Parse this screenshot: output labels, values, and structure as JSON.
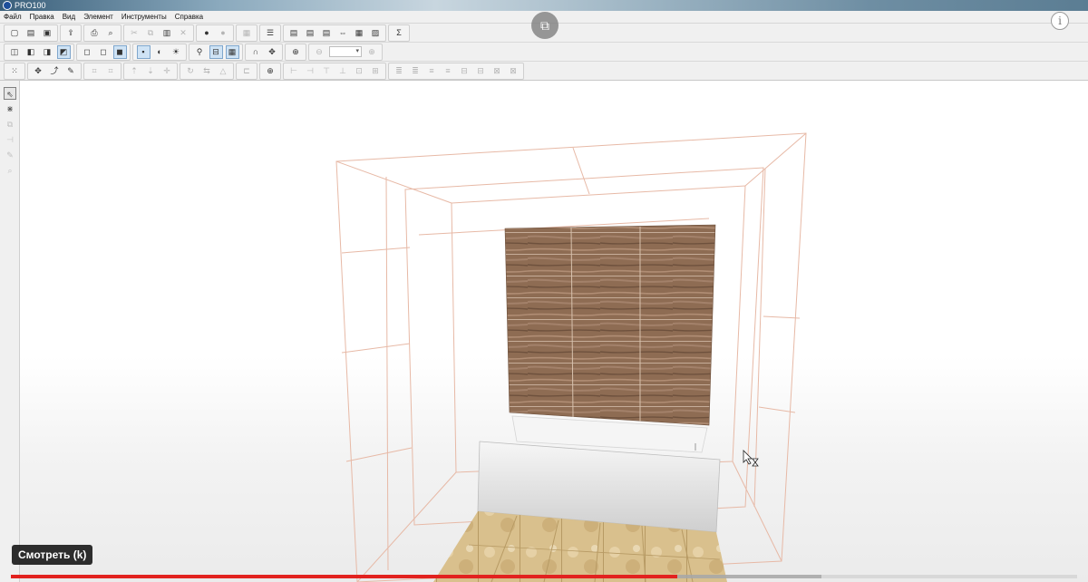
{
  "window": {
    "title": "PRO100"
  },
  "menu": [
    "Файл",
    "Правка",
    "Вид",
    "Элемент",
    "Инструменты",
    "Справка"
  ],
  "toolbar_1": {
    "groups": [
      [
        {
          "name": "new-icon",
          "glyph": "▢"
        },
        {
          "name": "open-icon",
          "glyph": "▤"
        },
        {
          "name": "save-icon",
          "glyph": "▣"
        }
      ],
      [
        {
          "name": "export-icon",
          "glyph": "⇪"
        }
      ],
      [
        {
          "name": "print-icon",
          "glyph": "⎙"
        },
        {
          "name": "print-preview-icon",
          "glyph": "⌕"
        }
      ],
      [
        {
          "name": "cut-icon",
          "glyph": "✂",
          "disabled": true
        },
        {
          "name": "copy-icon",
          "glyph": "⧉",
          "disabled": true
        },
        {
          "name": "paste-icon",
          "glyph": "▥"
        },
        {
          "name": "delete-icon",
          "glyph": "✕",
          "disabled": true
        }
      ],
      [
        {
          "name": "undo-icon",
          "glyph": "●"
        },
        {
          "name": "redo-icon",
          "glyph": "●",
          "disabled": true
        }
      ],
      [
        {
          "name": "properties-icon",
          "glyph": "▦",
          "disabled": true
        }
      ],
      [
        {
          "name": "element-list-icon",
          "glyph": "☰"
        }
      ],
      [
        {
          "name": "library-icon",
          "glyph": "▤"
        },
        {
          "name": "library-add-icon",
          "glyph": "▤"
        },
        {
          "name": "library-edit-icon",
          "glyph": "▤"
        },
        {
          "name": "dimensions-icon",
          "glyph": "⇔"
        },
        {
          "name": "report-icon",
          "glyph": "▦"
        },
        {
          "name": "catalog-icon",
          "glyph": "▨"
        }
      ],
      [
        {
          "name": "sum-icon",
          "glyph": "Σ"
        }
      ]
    ]
  },
  "toolbar_2": {
    "groups": [
      [
        {
          "name": "view-front-icon",
          "glyph": "◫"
        },
        {
          "name": "view-side-icon",
          "glyph": "◧"
        },
        {
          "name": "view-top-icon",
          "glyph": "◨"
        },
        {
          "name": "view-3d-icon",
          "glyph": "◩",
          "active": true
        }
      ],
      [
        {
          "name": "wireframe-icon",
          "glyph": "◻"
        },
        {
          "name": "hidden-lines-icon",
          "glyph": "◻"
        },
        {
          "name": "shaded-icon",
          "glyph": "◼",
          "active": true
        }
      ],
      [
        {
          "name": "texture-icon",
          "glyph": "▪",
          "active": true
        },
        {
          "name": "shadow-icon",
          "glyph": "◐"
        },
        {
          "name": "light-icon",
          "glyph": "☀"
        }
      ],
      [
        {
          "name": "measure-icon",
          "glyph": "⚲"
        },
        {
          "name": "dimension-line-icon",
          "glyph": "⊟",
          "active": true
        },
        {
          "name": "grid-icon",
          "glyph": "▦",
          "active": true
        }
      ],
      [
        {
          "name": "magnet-icon",
          "glyph": "∩"
        },
        {
          "name": "snap-icon",
          "glyph": "✥"
        }
      ],
      [
        {
          "name": "target-icon",
          "glyph": "⊕"
        }
      ],
      [
        {
          "name": "zoom-out-icon",
          "glyph": "⊖",
          "disabled": true
        },
        {
          "name": "zoom-field",
          "field": true
        },
        {
          "name": "zoom-in-icon",
          "glyph": "⊕",
          "disabled": true
        }
      ]
    ]
  },
  "toolbar_3": {
    "groups": [
      [
        {
          "name": "grid-snap-icon",
          "glyph": "⁙"
        }
      ],
      [
        {
          "name": "move-icon",
          "glyph": "✥"
        },
        {
          "name": "select-rotate-icon",
          "glyph": "⤴"
        },
        {
          "name": "edit-vertex-icon",
          "glyph": "✎"
        }
      ],
      [
        {
          "name": "align-frame-icon",
          "glyph": "⌗",
          "disabled": true
        },
        {
          "name": "align-grid-icon",
          "glyph": "⌗",
          "disabled": true
        }
      ],
      [
        {
          "name": "up-icon",
          "glyph": "⇡",
          "disabled": true
        },
        {
          "name": "down-icon",
          "glyph": "⇣",
          "disabled": true
        },
        {
          "name": "move-cross-icon",
          "glyph": "✛",
          "disabled": true
        }
      ],
      [
        {
          "name": "rotate-icon",
          "glyph": "↻",
          "disabled": true
        },
        {
          "name": "flip-icon",
          "glyph": "⇆",
          "disabled": true
        },
        {
          "name": "mirror-icon",
          "glyph": "△",
          "disabled": true
        }
      ],
      [
        {
          "name": "group-icon",
          "glyph": "⊏",
          "disabled": true
        }
      ],
      [
        {
          "name": "center-icon",
          "glyph": "⊕"
        }
      ],
      [
        {
          "name": "align-left-icon",
          "glyph": "⊢",
          "disabled": true
        },
        {
          "name": "align-hcenter-icon",
          "glyph": "⊣",
          "disabled": true
        },
        {
          "name": "align-top-icon",
          "glyph": "⊤",
          "disabled": true
        },
        {
          "name": "align-bottom-icon",
          "glyph": "⊥",
          "disabled": true
        },
        {
          "name": "align-depth-icon",
          "glyph": "⊡",
          "disabled": true
        },
        {
          "name": "align-front-icon",
          "glyph": "⊞",
          "disabled": true
        }
      ],
      [
        {
          "name": "distribute-1-icon",
          "glyph": "≣",
          "disabled": true
        },
        {
          "name": "distribute-2-icon",
          "glyph": "≣",
          "disabled": true
        },
        {
          "name": "distribute-3-icon",
          "glyph": "≡",
          "disabled": true
        },
        {
          "name": "distribute-4-icon",
          "glyph": "≡",
          "disabled": true
        },
        {
          "name": "distribute-5-icon",
          "glyph": "⊟",
          "disabled": true
        },
        {
          "name": "distribute-6-icon",
          "glyph": "⊟",
          "disabled": true
        },
        {
          "name": "distribute-7-icon",
          "glyph": "⊠",
          "disabled": true
        },
        {
          "name": "distribute-8-icon",
          "glyph": "⊠",
          "disabled": true
        }
      ]
    ]
  },
  "left_tools": [
    {
      "name": "pointer-tool-icon",
      "glyph": "⇖",
      "active": true
    },
    {
      "name": "spray-tool-icon",
      "glyph": "⋇"
    },
    {
      "name": "copy-tool-icon",
      "glyph": "⧉",
      "disabled": true
    },
    {
      "name": "dimension-tool-icon",
      "glyph": "⊣",
      "disabled": true
    },
    {
      "name": "edit-tool-icon",
      "glyph": "✎",
      "disabled": true
    },
    {
      "name": "zoom-tool-icon",
      "glyph": "⌕",
      "disabled": true
    }
  ],
  "overlay": {
    "popout_icon": "⧉",
    "info_icon": "i",
    "watch_label": "Смотреть (k)",
    "progress_fraction": 0.625,
    "buffer_fraction": 0.76
  },
  "colors": {
    "room_lines": "#e7b9a6",
    "wood": "#8e6c53",
    "wood_dark": "#6e513d",
    "floor": "#d9c08d",
    "bath": "#e4e4e4",
    "progress": "#e2221f"
  }
}
